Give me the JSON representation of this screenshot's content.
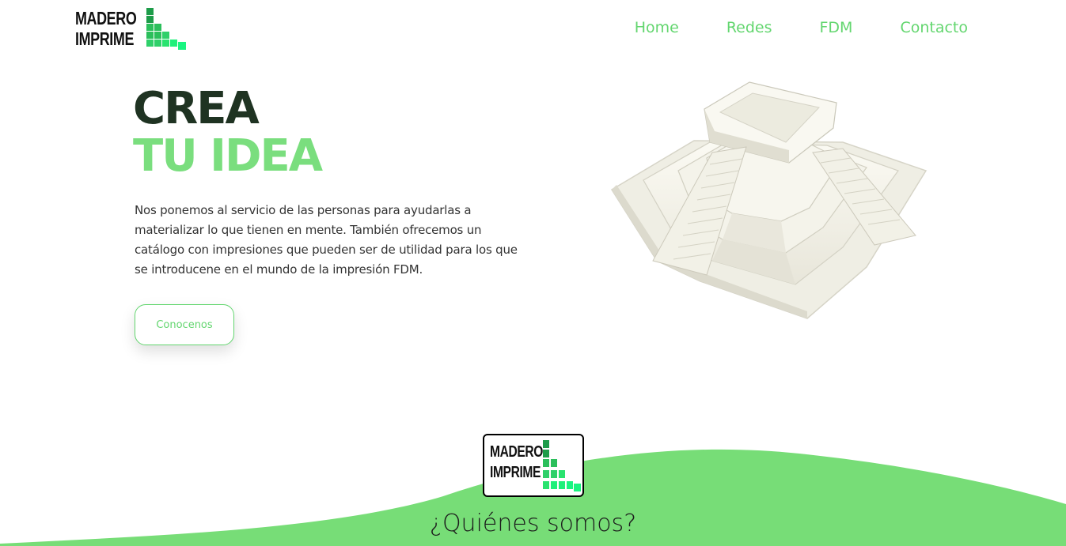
{
  "brand": {
    "line1": "MADERO",
    "line2": "IMPRIME"
  },
  "nav": {
    "items": [
      "Home",
      "Redes",
      "FDM",
      "Contacto"
    ]
  },
  "hero": {
    "title_line1": "CREA",
    "title_line2": "TU IDEA",
    "description": "Nos ponemos al servicio de las personas para ayudarlas a materializar lo que tienen en mente. También ofrecemos un catálogo con impresiones que pueden ser de utilidad para los que se introducene en el mundo de la impresión FDM.",
    "cta_label": "Conocenos"
  },
  "about": {
    "title": "¿Quiénes somos?"
  },
  "colors": {
    "accent": "#7ade7e",
    "nav_text": "#63d66f",
    "title_dark": "#1f3322",
    "wave": "#77dd77"
  }
}
